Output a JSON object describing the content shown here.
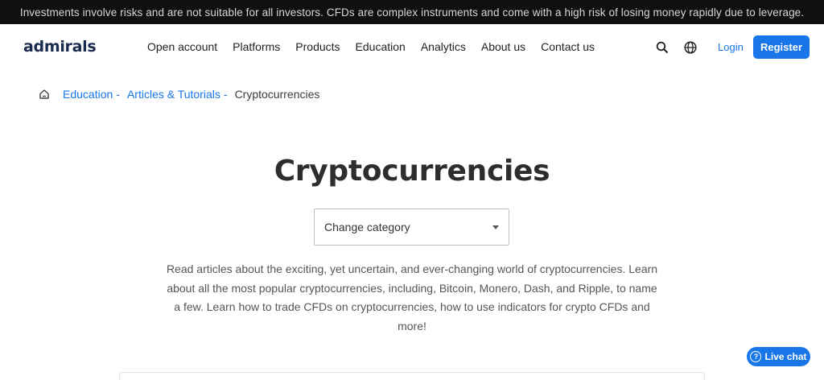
{
  "risk_banner": {
    "text": "Investments involve risks and are not suitable for all investors. CFDs are complex instruments and come with a high risk of losing money rapidly due to leverage."
  },
  "header": {
    "logo": "admirals",
    "nav": [
      "Open account",
      "Platforms",
      "Products",
      "Education",
      "Analytics",
      "About us",
      "Contact us"
    ],
    "icons": {
      "search": "search-icon",
      "language": "globe-icon"
    },
    "login_label": "Login",
    "register_label": "Register"
  },
  "breadcrumb": {
    "home_icon": "home-icon",
    "items": [
      "Education",
      "Articles & Tutorials"
    ],
    "separator": "-",
    "current": "Cryptocurrencies"
  },
  "main": {
    "title": "Cryptocurrencies",
    "category_select": {
      "selected": "Change category"
    },
    "description": "Read articles about the exciting, yet uncertain, and ever-changing world of cryptocurrencies. Learn about all the most popular cryptocurrencies, including, Bitcoin, Monero, Dash, and Ripple, to name a few. Learn how to trade CFDs on cryptocurrencies, how to use indicators for crypto CFDs and more!"
  },
  "live_chat": {
    "label": "Live chat",
    "icon": "help-icon"
  },
  "colors": {
    "accent": "#1876e8",
    "banner_bg": "#101010",
    "logo": "#1a2b4f"
  }
}
